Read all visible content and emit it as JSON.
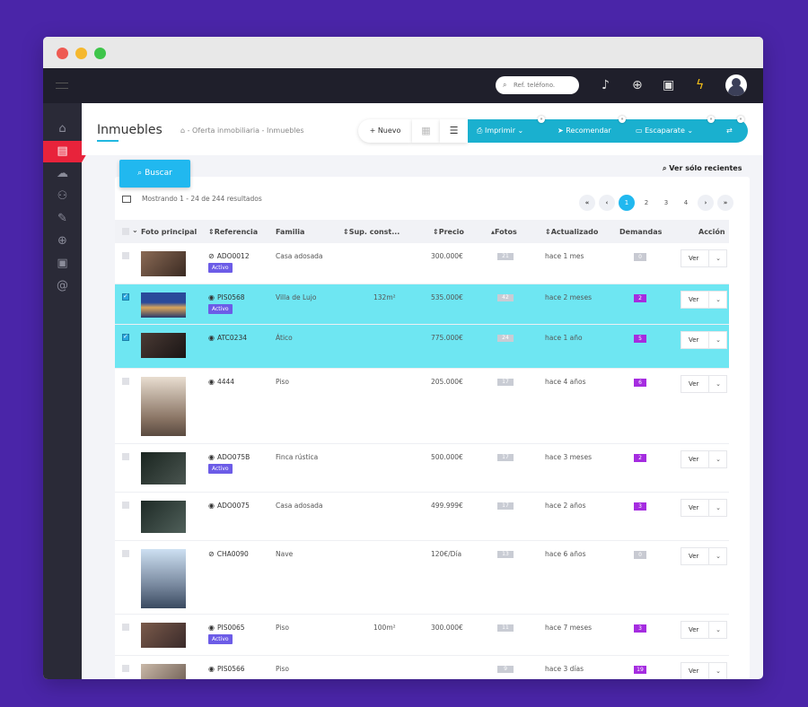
{
  "topbar": {
    "search_placeholder": "Ref. teléfono.",
    "icons": [
      "menu-icon",
      "search-icon",
      "bell-icon",
      "globe-icon",
      "briefcase-icon",
      "bolt-icon",
      "avatar"
    ]
  },
  "sidebar": {
    "items": [
      {
        "name": "home-icon",
        "glyph": "⌂"
      },
      {
        "name": "building-icon",
        "glyph": "▤"
      },
      {
        "name": "cloud-icon",
        "glyph": "☁"
      },
      {
        "name": "users-icon",
        "glyph": "⚇"
      },
      {
        "name": "wrench-icon",
        "glyph": "✎"
      },
      {
        "name": "globe-icon",
        "glyph": "⊕"
      },
      {
        "name": "briefcase-icon",
        "glyph": "▣"
      },
      {
        "name": "at-icon",
        "glyph": "@"
      }
    ]
  },
  "header": {
    "title": "Inmuebles",
    "breadcrumb": "- Oferta inmobiliaria - Inmuebles",
    "nuevo": "Nuevo",
    "imprimir": "Imprimir",
    "recomendar": "Recomendar",
    "escaparate": "Escaparate"
  },
  "buscar": "Buscar",
  "recientes": "Ver sólo recientes",
  "results_text": "Mostrando 1 - 24 de 244 resultados",
  "pagination": [
    "1",
    "2",
    "3",
    "4"
  ],
  "columns": {
    "foto": "Foto principal",
    "referencia": "Referencia",
    "familia": "Familia",
    "sup": "Sup. const...",
    "precio": "Precio",
    "fotos": "Fotos",
    "actualizado": "Actualizado",
    "demandas": "Demandas",
    "accion": "Acción"
  },
  "rows": [
    {
      "ref": "ADO0012",
      "visible": false,
      "estado": "Activo",
      "familia": "Casa adosada",
      "sup": "",
      "precio": "300.000€",
      "fotos": "21",
      "actualizado": "hace 1 mes",
      "demandas": "0",
      "selected": false,
      "ver": "Ver"
    },
    {
      "ref": "PIS0568",
      "visible": true,
      "estado": "Activo",
      "familia": "Villa de Lujo",
      "sup": "132m²",
      "precio": "535.000€",
      "fotos": "42",
      "actualizado": "hace 2 meses",
      "demandas": "2",
      "selected": true,
      "ver": "Ver"
    },
    {
      "ref": "ATC0234",
      "visible": true,
      "estado": "",
      "familia": "Ático",
      "sup": "",
      "precio": "775.000€",
      "fotos": "24",
      "actualizado": "hace 1 año",
      "demandas": "5",
      "selected": true,
      "ver": "Ver"
    },
    {
      "ref": "4444",
      "visible": true,
      "estado": "",
      "familia": "Piso",
      "sup": "",
      "precio": "205.000€",
      "fotos": "17",
      "actualizado": "hace 4 años",
      "demandas": "6",
      "selected": false,
      "ver": "Ver"
    },
    {
      "ref": "ADO075B",
      "visible": true,
      "estado": "Activo",
      "familia": "Finca rústica",
      "sup": "",
      "precio": "500.000€",
      "fotos": "17",
      "actualizado": "hace 3 meses",
      "demandas": "2",
      "selected": false,
      "ver": "Ver"
    },
    {
      "ref": "ADO0075",
      "visible": true,
      "estado": "",
      "familia": "Casa adosada",
      "sup": "",
      "precio": "499.999€",
      "fotos": "17",
      "actualizado": "hace 2 años",
      "demandas": "3",
      "selected": false,
      "ver": "Ver"
    },
    {
      "ref": "CHA0090",
      "visible": false,
      "estado": "",
      "familia": "Nave",
      "sup": "",
      "precio": "120€/Día",
      "fotos": "13",
      "actualizado": "hace 6 años",
      "demandas": "0",
      "selected": false,
      "ver": "Ver"
    },
    {
      "ref": "PIS0065",
      "visible": true,
      "estado": "Activo",
      "familia": "Piso",
      "sup": "100m²",
      "precio": "300.000€",
      "fotos": "11",
      "actualizado": "hace 7 meses",
      "demandas": "3",
      "selected": false,
      "ver": "Ver"
    },
    {
      "ref": "PIS0566",
      "visible": true,
      "estado": "",
      "familia": "Piso",
      "sup": "",
      "precio": "",
      "fotos": "9",
      "actualizado": "hace 3 días",
      "demandas": "19",
      "selected": false,
      "ver": "Ver"
    }
  ],
  "colors": {
    "accent": "#21b8ef",
    "teal": "#1ab0cf",
    "selected_row": "#6ee6f2",
    "sidebar_active": "#e8233b",
    "estado_badge": "#6c5ce7",
    "demandas_badge": "#a52ce0"
  }
}
